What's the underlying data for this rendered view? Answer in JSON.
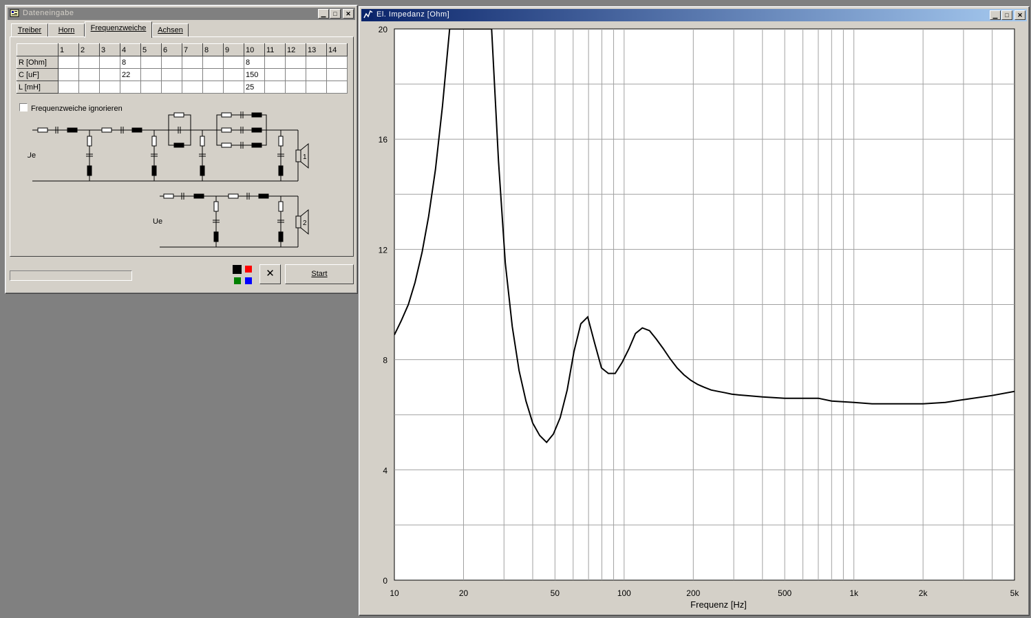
{
  "data_window": {
    "title": "Dateneingabe",
    "tabs": [
      "Treiber",
      "Horn",
      "Frequenzweiche",
      "Achsen"
    ],
    "selected_tab": 2,
    "table": {
      "columns": [
        "1",
        "2",
        "3",
        "4",
        "5",
        "6",
        "7",
        "8",
        "9",
        "10",
        "11",
        "12",
        "13",
        "14"
      ],
      "rows": [
        {
          "label": "R [Ohm]",
          "cells": [
            "",
            "",
            "",
            "8",
            "",
            "",
            "",
            "",
            "",
            "8",
            "",
            "",
            "",
            ""
          ]
        },
        {
          "label": "C [uF]",
          "cells": [
            "",
            "",
            "",
            "22",
            "",
            "",
            "",
            "",
            "",
            "150",
            "",
            "",
            "",
            ""
          ]
        },
        {
          "label": "L [mH]",
          "cells": [
            "",
            "",
            "",
            "",
            "",
            "",
            "",
            "",
            "",
            "25",
            "",
            "",
            "",
            ""
          ]
        }
      ]
    },
    "ignore_crossover_label": "Frequenzweiche ignorieren",
    "ignore_crossover_checked": false,
    "circuit": {
      "input_label_1": "Ue",
      "input_label_2": "Ue",
      "speaker_1": "1",
      "speaker_2": "2"
    },
    "color_swatches": [
      "#000000",
      "#ff0000",
      "#008000",
      "#0000ff"
    ],
    "start_label": "Start",
    "cancel_symbol": "✕"
  },
  "chart_window": {
    "title": "El. Impedanz [Ohm]"
  },
  "chart_data": {
    "type": "line",
    "xlabel": "Frequenz [Hz]",
    "x_scale": "log",
    "xlim": [
      10,
      5000
    ],
    "ylim": [
      0,
      20
    ],
    "x_ticks": [
      10,
      20,
      50,
      100,
      200,
      500,
      1000,
      2000,
      5000
    ],
    "x_tick_labels": [
      "10",
      "20",
      "50",
      "100",
      "200",
      "500",
      "1k",
      "2k",
      "5k"
    ],
    "y_ticks": [
      0,
      4,
      8,
      12,
      16,
      20
    ],
    "y_tick_labels": [
      "0",
      "4",
      "8",
      "12",
      "16",
      "20"
    ],
    "grid": true,
    "series": [
      {
        "color": "#000000",
        "x": [
          10,
          10.7,
          11.5,
          12.3,
          13.2,
          14.1,
          15.1,
          16.2,
          17.4,
          18.6,
          26.5,
          28.4,
          30.4,
          32.6,
          34.9,
          37.4,
          40.0,
          42.9,
          46.0,
          49.2,
          52.7,
          56.5,
          60.5,
          64.8,
          69.4,
          74.4,
          79.7,
          85.4,
          91.4,
          98.0,
          105,
          112,
          120,
          129,
          138,
          148,
          158,
          170,
          182,
          195,
          209,
          223,
          239,
          256,
          275,
          294,
          316,
          340,
          400,
          500,
          600,
          700,
          800,
          1000,
          1200,
          1500,
          2000,
          2500,
          3000,
          4000,
          5000
        ],
        "values": [
          8.9,
          9.4,
          10.0,
          10.8,
          11.9,
          13.2,
          14.9,
          17.2,
          20.0,
          21.0,
          21.0,
          15.2,
          11.5,
          9.2,
          7.6,
          6.5,
          5.7,
          5.25,
          5.0,
          5.3,
          5.9,
          6.9,
          8.3,
          9.3,
          9.55,
          8.6,
          7.7,
          7.5,
          7.5,
          7.9,
          8.4,
          8.95,
          9.15,
          9.05,
          8.75,
          8.4,
          8.05,
          7.7,
          7.45,
          7.25,
          7.1,
          7.0,
          6.9,
          6.85,
          6.8,
          6.75,
          6.72,
          6.7,
          6.65,
          6.6,
          6.6,
          6.6,
          6.5,
          6.45,
          6.4,
          6.4,
          6.4,
          6.45,
          6.55,
          6.7,
          6.85
        ]
      }
    ]
  }
}
